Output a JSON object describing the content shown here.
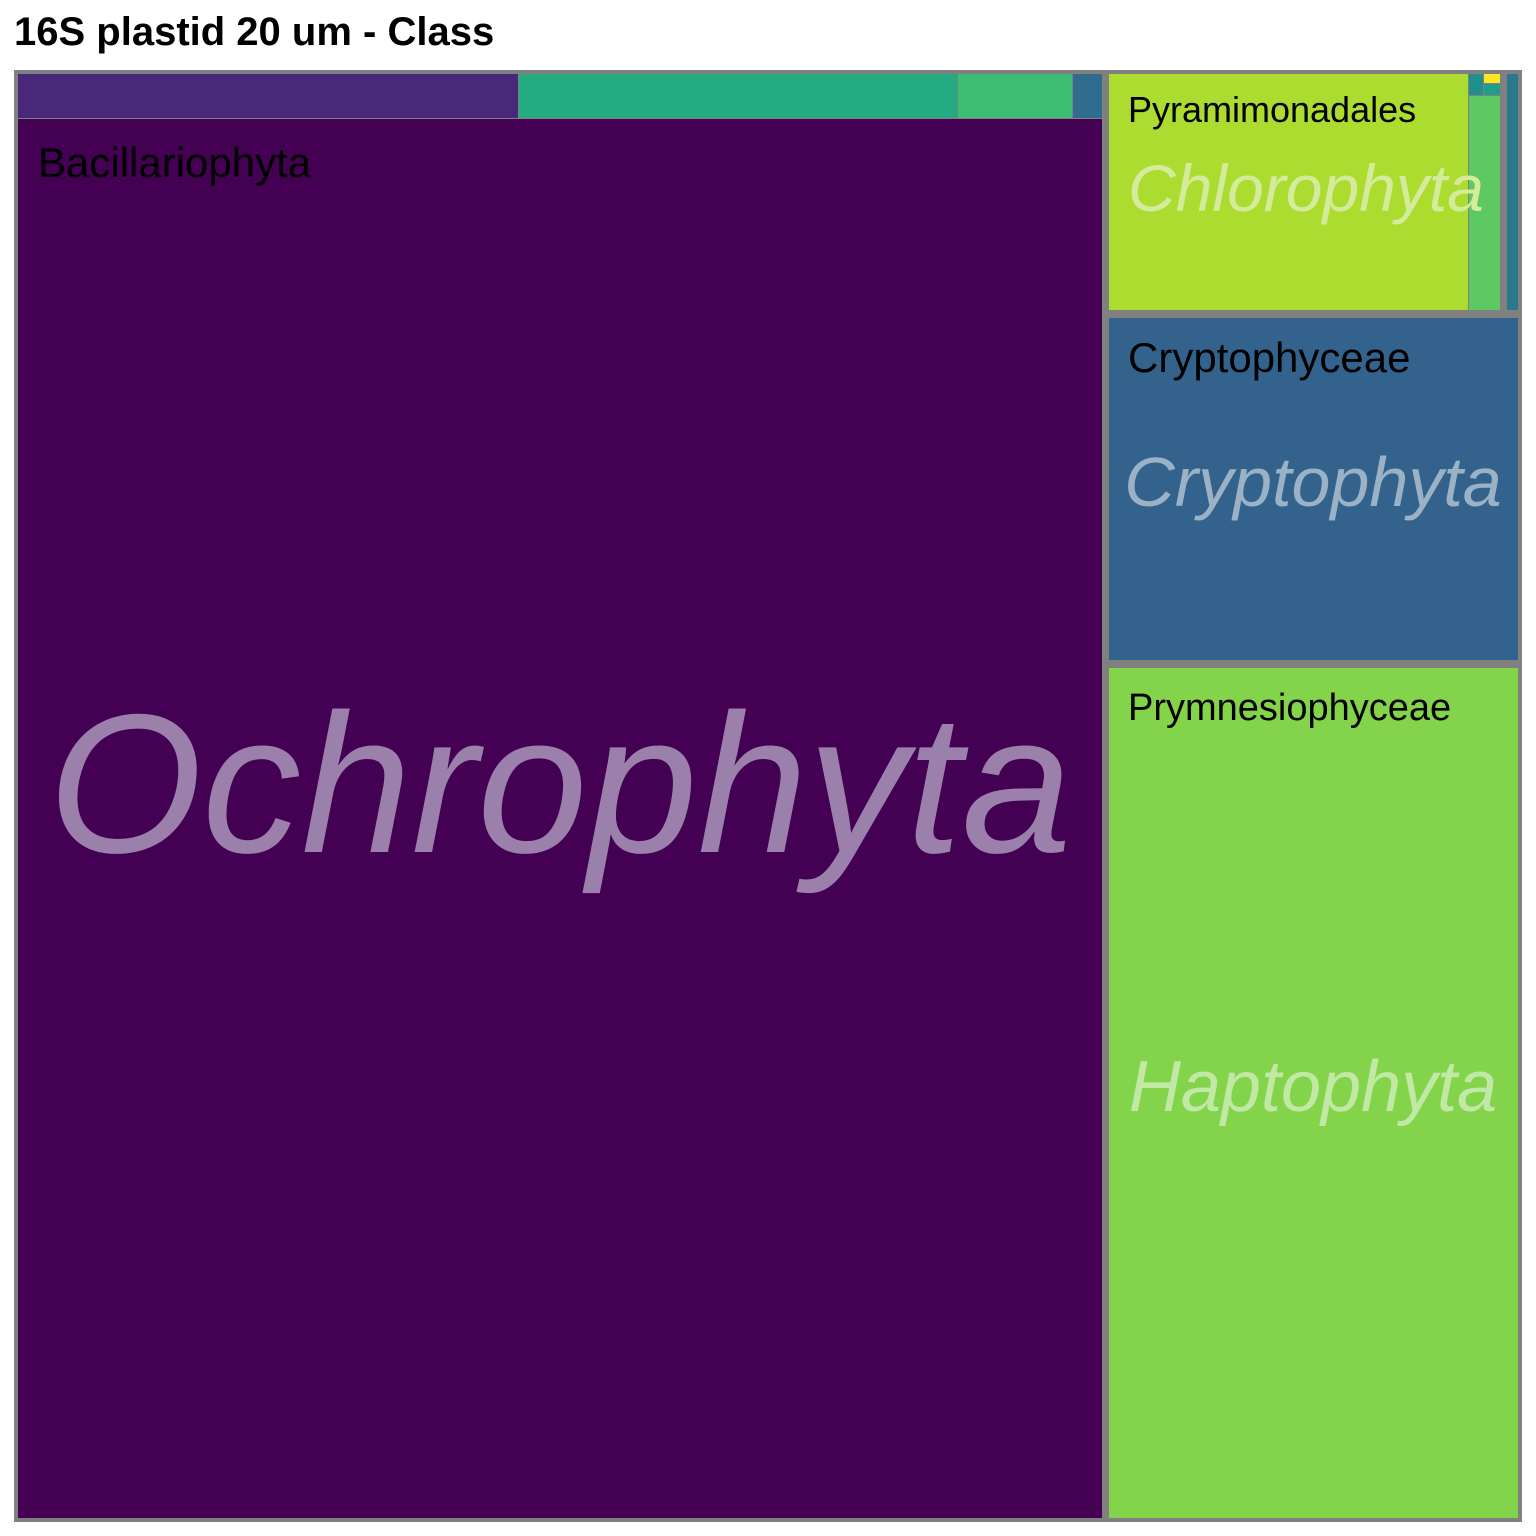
{
  "chart_data": {
    "type": "treemap",
    "title": "16S plastid 20 um - Class",
    "groups": [
      {
        "phylum": "Ochrophyta",
        "classes": [
          {
            "name": "Bacillariophyta",
            "color": "#440154"
          },
          {
            "name": "",
            "color": "#482878"
          },
          {
            "name": "",
            "color": "#25AB82"
          },
          {
            "name": "",
            "color": "#3DBC74"
          },
          {
            "name": "",
            "color": "#2F6C8E"
          }
        ]
      },
      {
        "phylum": "Chlorophyta",
        "classes": [
          {
            "name": "Pyramimonadales",
            "color": "#ADDC30"
          },
          {
            "name": "",
            "color": "#5EC962"
          },
          {
            "name": "",
            "color": "#21908D"
          },
          {
            "name": "",
            "color": "#FDE725"
          },
          {
            "name": "",
            "color": "#1F9E89"
          },
          {
            "name": "",
            "color": "#2A788E"
          }
        ]
      },
      {
        "phylum": "Cryptophyta",
        "classes": [
          {
            "name": "Cryptophyceae",
            "color": "#33638D"
          }
        ]
      },
      {
        "phylum": "Haptophyta",
        "classes": [
          {
            "name": "Prymnesiophyceae",
            "color": "#84D44B"
          }
        ]
      }
    ]
  }
}
